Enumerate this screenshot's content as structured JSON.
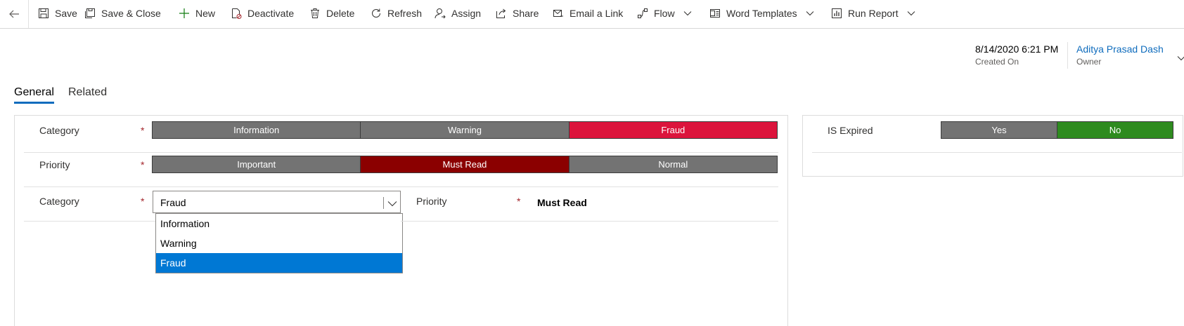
{
  "toolbar": {
    "save": "Save",
    "save_close": "Save & Close",
    "new": "New",
    "deactivate": "Deactivate",
    "delete": "Delete",
    "refresh": "Refresh",
    "assign": "Assign",
    "share": "Share",
    "email_link": "Email a Link",
    "flow": "Flow",
    "word_templates": "Word Templates",
    "run_report": "Run Report"
  },
  "header": {
    "created_on_value": "8/14/2020 6:21 PM",
    "created_on_label": "Created On",
    "owner_value": "Aditya Prasad Dash",
    "owner_label": "Owner"
  },
  "tabs": [
    {
      "label": "General",
      "active": true
    },
    {
      "label": "Related",
      "active": false
    }
  ],
  "form": {
    "category_label": "Category",
    "priority_label": "Priority",
    "required_mark": "*",
    "category_options": [
      {
        "label": "Information",
        "color": "#737373"
      },
      {
        "label": "Warning",
        "color": "#737373"
      },
      {
        "label": "Fraud",
        "color": "#dc143c"
      }
    ],
    "priority_options": [
      {
        "label": "Important",
        "color": "#737373"
      },
      {
        "label": "Must Read",
        "color": "#8b0000"
      },
      {
        "label": "Normal",
        "color": "#737373"
      }
    ],
    "category_select_value": "Fraud",
    "category_dropdown_options": [
      "Information",
      "Warning",
      "Fraud"
    ],
    "category_dropdown_selected": "Fraud",
    "priority_value": "Must Read"
  },
  "side": {
    "is_expired_label": "IS Expired",
    "is_expired_options": [
      {
        "label": "Yes",
        "color": "#737373"
      },
      {
        "label": "No",
        "color": "#2e8b1f"
      }
    ]
  },
  "colors": {
    "accent": "#0f6cbd",
    "link": "#0f6cbd",
    "dropdown_selected": "#0078d4",
    "required": "#a4262c"
  }
}
